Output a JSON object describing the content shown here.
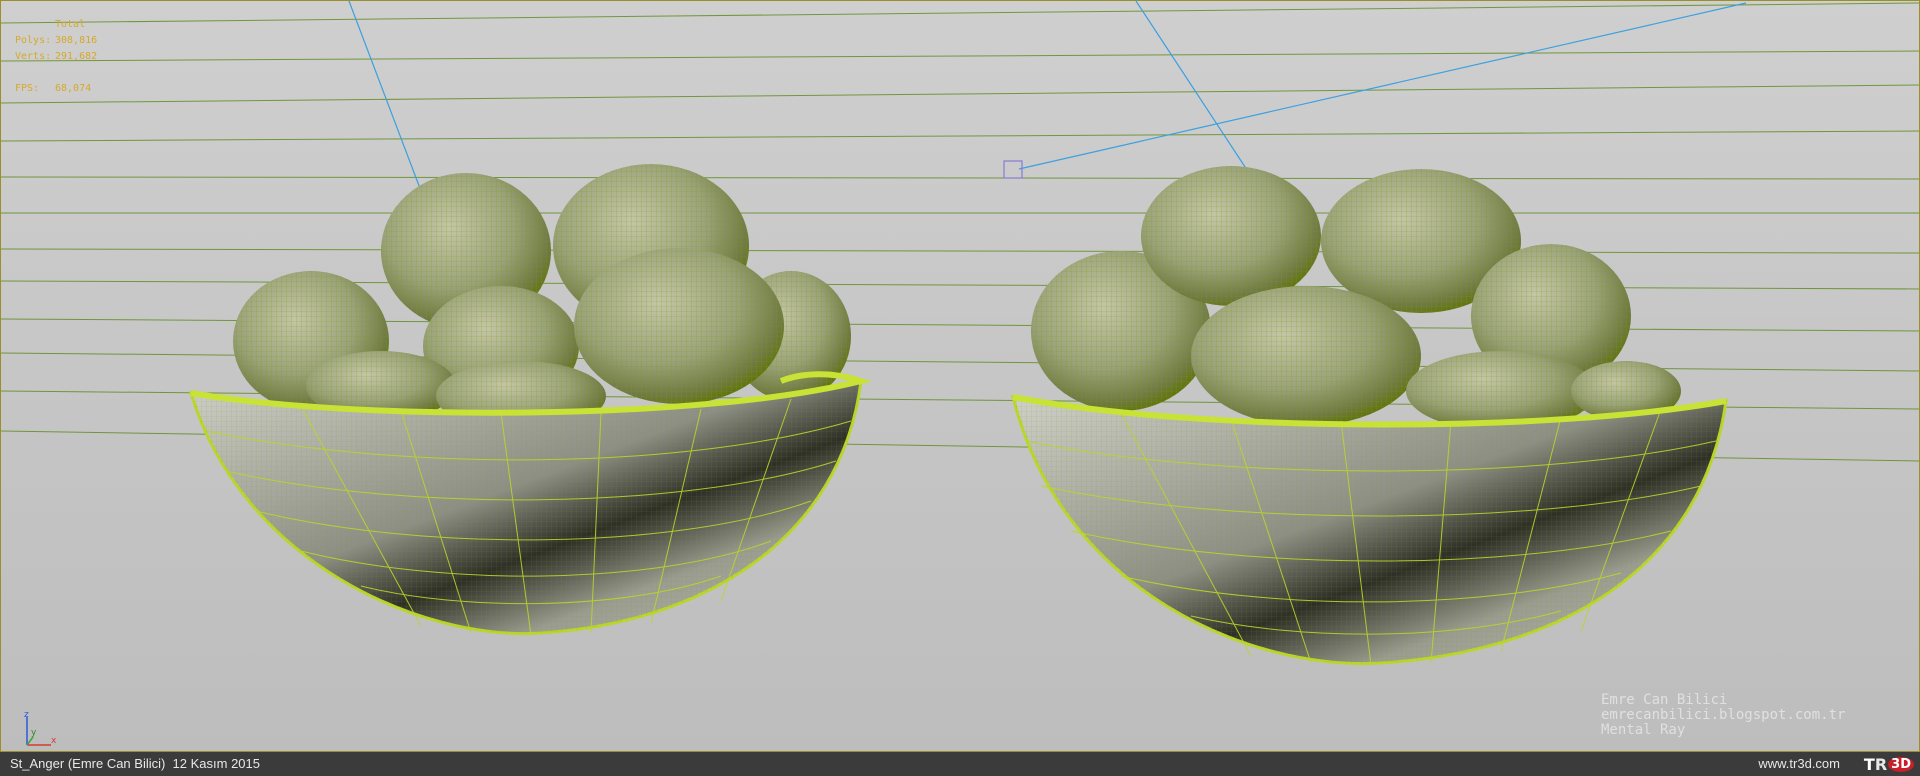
{
  "stats": {
    "mode": "Total",
    "polys_label": "Polys:",
    "polys_value": "308,816",
    "verts_label": "Verts:",
    "verts_value": "291,682",
    "fps_label": "FPS:",
    "fps_value": "68,074"
  },
  "axis": {
    "z": "z",
    "y": "y",
    "x": "x"
  },
  "watermark": {
    "line1": "Emre Can Bilici",
    "line2": "emrecanbilici.blogspot.com.tr",
    "line3": "Mental Ray"
  },
  "statusbar": {
    "title": "St_Anger (Emre Can Bilici)  12 Kasım 2015",
    "url": "www.tr3d.com",
    "logo_t": "T",
    "logo_r": "R",
    "logo_3d": "3D"
  },
  "colors": {
    "wire": "#b9d62a",
    "apple_dark": "#6f8a00",
    "apple_light": "#a8ac88",
    "background": "#c9c9c9",
    "statusbar": "#3b3b3b",
    "stats_text": "#d6a92a"
  },
  "icons": {
    "axis": "axis-tripod-icon",
    "camera_target": "camera-target-icon",
    "logo": "tr3d-logo-icon"
  }
}
